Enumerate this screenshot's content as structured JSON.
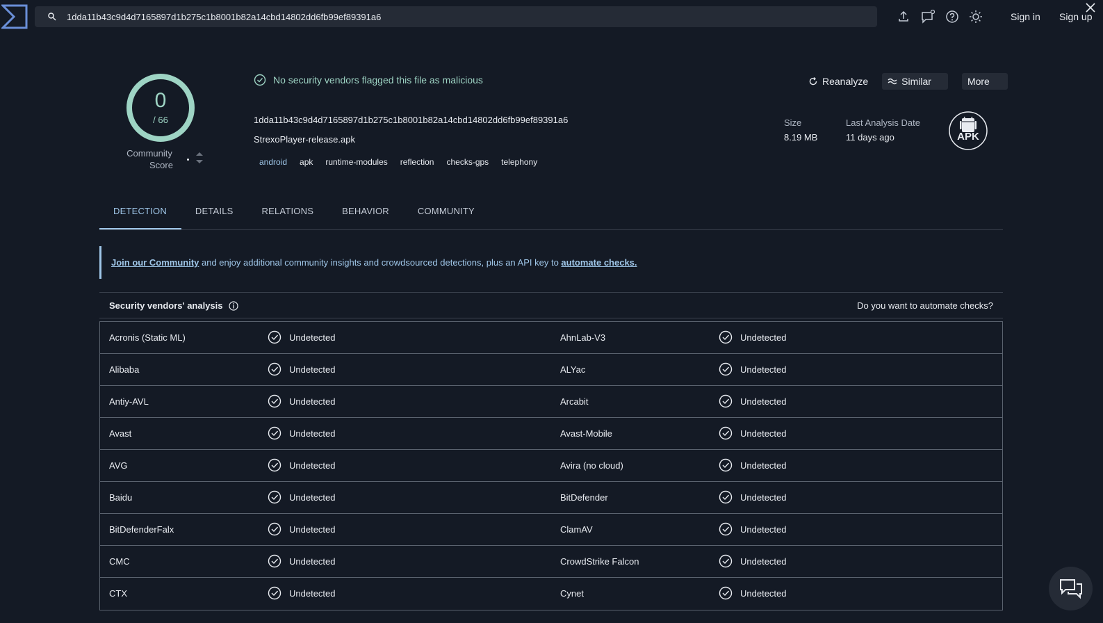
{
  "topbar": {
    "search_value": "1dda11b43c9d4d7165897d1b275c1b8001b82a14cbd14802dd6fb99ef89391a6",
    "sign_in": "Sign in",
    "sign_up": "Sign up",
    "icons": [
      "upload-icon",
      "notifications-icon",
      "help-icon",
      "theme-icon",
      "close-icon"
    ]
  },
  "score": {
    "detections": "0",
    "total": "/ 66",
    "community_label_1": "Community",
    "community_label_2": "Score"
  },
  "file": {
    "status": "No security vendors flagged this file as malicious",
    "hash": "1dda11b43c9d4d7165897d1b275c1b8001b82a14cbd14802dd6fb99ef89391a6",
    "name": "StrexoPlayer-release.apk",
    "tags": [
      "android",
      "apk",
      "runtime-modules",
      "reflection",
      "checks-gps",
      "telephony"
    ],
    "size_label": "Size",
    "size_value": "8.19 MB",
    "date_label": "Last Analysis Date",
    "date_value": "11 days ago",
    "type_badge": "APK"
  },
  "actions": {
    "reanalyze": "Reanalyze",
    "similar": "Similar",
    "more": "More"
  },
  "tabs": [
    "DETECTION",
    "DETAILS",
    "RELATIONS",
    "BEHAVIOR",
    "COMMUNITY"
  ],
  "banner": {
    "link1": "Join our Community",
    "text": " and enjoy additional community insights and crowdsourced detections, plus an API key to ",
    "link2": "automate checks."
  },
  "vendors": {
    "title": "Security vendors' analysis",
    "automate": "Do you want to automate checks?",
    "rows": [
      {
        "left": "Acronis (Static ML)",
        "left_result": "Undetected",
        "right": "AhnLab-V3",
        "right_result": "Undetected"
      },
      {
        "left": "Alibaba",
        "left_result": "Undetected",
        "right": "ALYac",
        "right_result": "Undetected"
      },
      {
        "left": "Antiy-AVL",
        "left_result": "Undetected",
        "right": "Arcabit",
        "right_result": "Undetected"
      },
      {
        "left": "Avast",
        "left_result": "Undetected",
        "right": "Avast-Mobile",
        "right_result": "Undetected"
      },
      {
        "left": "AVG",
        "left_result": "Undetected",
        "right": "Avira (no cloud)",
        "right_result": "Undetected"
      },
      {
        "left": "Baidu",
        "left_result": "Undetected",
        "right": "BitDefender",
        "right_result": "Undetected"
      },
      {
        "left": "BitDefenderFalx",
        "left_result": "Undetected",
        "right": "ClamAV",
        "right_result": "Undetected"
      },
      {
        "left": "CMC",
        "left_result": "Undetected",
        "right": "CrowdStrike Falcon",
        "right_result": "Undetected"
      },
      {
        "left": "CTX",
        "left_result": "Undetected",
        "right": "Cynet",
        "right_result": "Undetected"
      }
    ]
  },
  "colors": {
    "background": "#141a25",
    "accent_green": "#9ed4c4",
    "accent_blue": "#9fc6e8"
  }
}
